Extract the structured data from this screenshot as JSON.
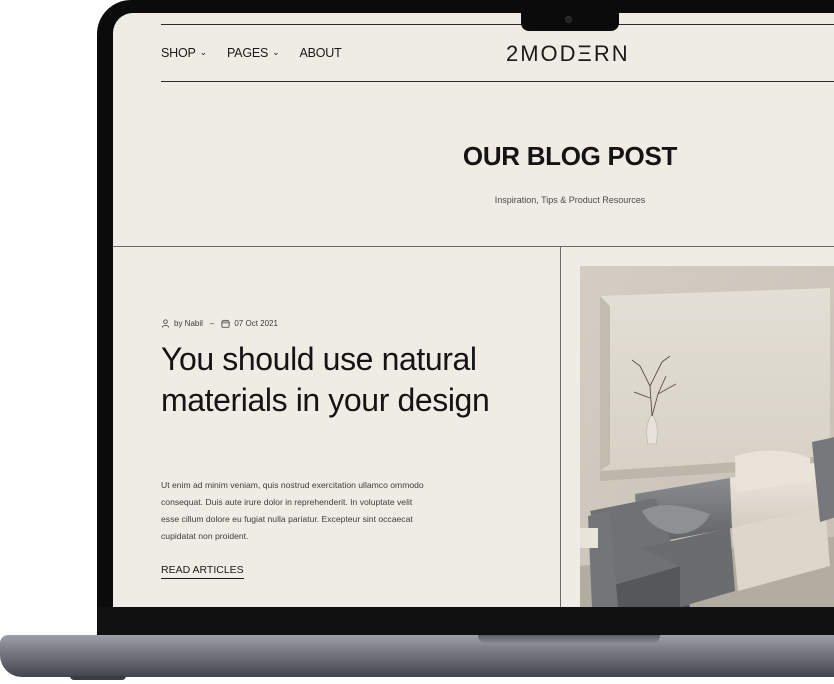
{
  "nav": {
    "items": [
      {
        "label": "SHOP",
        "has_dropdown": true
      },
      {
        "label": "PAGES",
        "has_dropdown": true
      },
      {
        "label": "ABOUT",
        "has_dropdown": false
      }
    ],
    "logo": "2MODΞRN"
  },
  "hero": {
    "title": "OUR BLOG POST",
    "subtitle": "Inspiration, Tips & Product Resources"
  },
  "article": {
    "author": "by Nabil",
    "separator": "–",
    "date": "07 Oct 2021",
    "title": "You should use natural materials in your design",
    "body": "Ut enim ad minim veniam, quis nostrud exercitation ullamco ommodo consequat. Duis aute irure dolor in reprehenderit. In voluptate velit esse cillum dolore eu fugiat nulla pariatur. Excepteur sint occaecat cupidatat non proident.",
    "link": "READ ARTICLES",
    "image": "living-room-sofa-photo"
  },
  "colors": {
    "page_bg": "#efece6",
    "text": "#141414",
    "bezel": "#0b0b0c",
    "sofa_gray": "#7a7c7f",
    "sofa_cream": "#e6e0d5"
  }
}
